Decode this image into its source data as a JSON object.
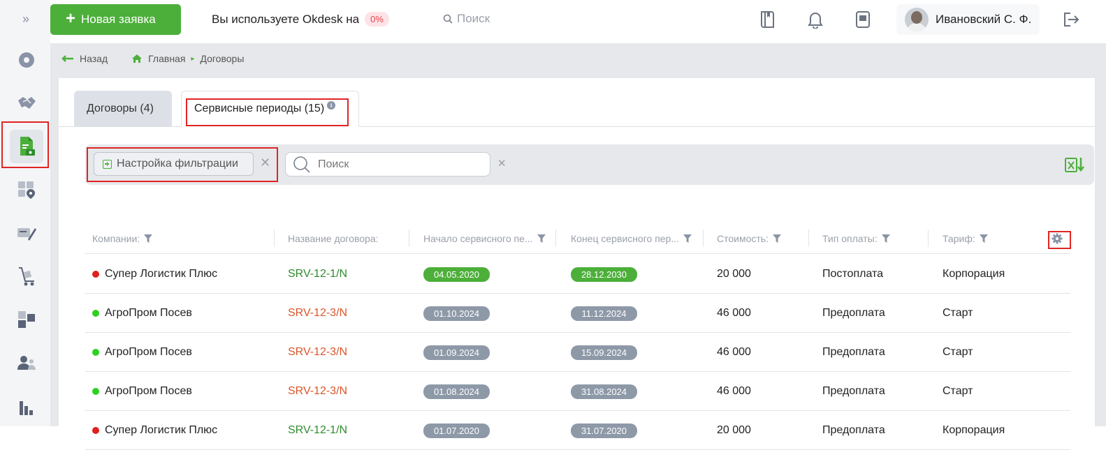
{
  "sidebar": {
    "items": [
      {
        "icon": "dashboard-icon"
      },
      {
        "icon": "handshake-icon"
      },
      {
        "icon": "contract-document-icon"
      },
      {
        "icon": "objects-map-icon"
      },
      {
        "icon": "equipment-tools-icon"
      },
      {
        "icon": "warehouse-cart-icon"
      },
      {
        "icon": "structure-icon"
      },
      {
        "icon": "employees-icon"
      },
      {
        "icon": "reports-chart-icon"
      }
    ]
  },
  "topbar": {
    "new_request": "Новая заявка",
    "usage_text": "Вы используете Okdesk на",
    "usage_value": "0%",
    "search_placeholder": "Поиск",
    "user_name": "Ивановский С. Ф."
  },
  "breadcrumbs": {
    "back": "Назад",
    "home": "Главная",
    "current": "Договоры"
  },
  "tabs": [
    {
      "label": "Договоры (4)"
    },
    {
      "label": "Сервисные периоды (15)"
    }
  ],
  "filters": {
    "setup_label": "Настройка фильтрации",
    "search_placeholder": "Поиск"
  },
  "table": {
    "columns": [
      "Компании:",
      "Название договора:",
      "Начало сервисного пе...",
      "Конец сервисного пер...",
      "Стоимость:",
      "Тип оплаты:",
      "Тариф:"
    ],
    "rows": [
      {
        "status_color": "#e0201e",
        "company": "Супер Логистик Плюс",
        "contract": "SRV-12-1/N",
        "contract_color": "#2e8b2e",
        "start": "04.05.2020",
        "start_color": "#4caf3a",
        "end": "28.12.2030",
        "end_color": "#4caf3a",
        "cost": "20 000",
        "payment": "Постоплата",
        "tariff": "Корпорация"
      },
      {
        "status_color": "#2ad21e",
        "company": "АгроПром Посев",
        "contract": "SRV-12-3/N",
        "contract_color": "#d9552a",
        "start": "01.10.2024",
        "start_color": "#8e99a8",
        "end": "11.12.2024",
        "end_color": "#8e99a8",
        "cost": "46 000",
        "payment": "Предоплата",
        "tariff": "Старт"
      },
      {
        "status_color": "#2ad21e",
        "company": "АгроПром Посев",
        "contract": "SRV-12-3/N",
        "contract_color": "#d9552a",
        "start": "01.09.2024",
        "start_color": "#8e99a8",
        "end": "15.09.2024",
        "end_color": "#8e99a8",
        "cost": "46 000",
        "payment": "Предоплата",
        "tariff": "Старт"
      },
      {
        "status_color": "#2ad21e",
        "company": "АгроПром Посев",
        "contract": "SRV-12-3/N",
        "contract_color": "#d9552a",
        "start": "01.08.2024",
        "start_color": "#8e99a8",
        "end": "31.08.2024",
        "end_color": "#8e99a8",
        "cost": "46 000",
        "payment": "Предоплата",
        "tariff": "Старт"
      },
      {
        "status_color": "#e0201e",
        "company": "Супер Логистик Плюс",
        "contract": "SRV-12-1/N",
        "contract_color": "#2e8b2e",
        "start": "01.07.2020",
        "start_color": "#8e99a8",
        "end": "31.07.2020",
        "end_color": "#8e99a8",
        "cost": "20 000",
        "payment": "Предоплата",
        "tariff": "Корпорация"
      }
    ]
  },
  "colors": {
    "accent_green": "#4caf3a",
    "highlight_red": "#e02424",
    "muted_gray": "#8e99a8"
  }
}
